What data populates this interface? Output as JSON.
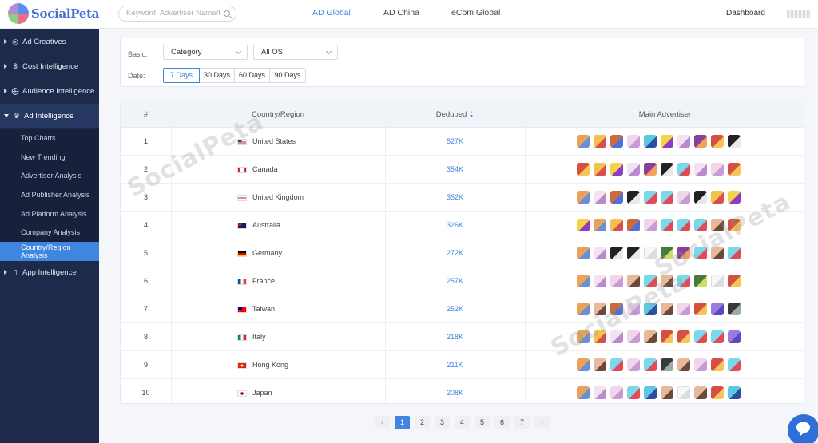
{
  "header": {
    "logo_text": "SocialPeta",
    "search_placeholder": "Keyword, Advertiser Name/ID",
    "tabs": [
      {
        "label": "AD Global",
        "active": true
      },
      {
        "label": "AD China",
        "active": false
      },
      {
        "label": "eCom Global",
        "active": false
      }
    ],
    "dashboard_label": "Dashboard"
  },
  "sidebar": {
    "main_items": [
      {
        "label": "Ad Creatives",
        "icon": "lightbulb-icon"
      },
      {
        "label": "Cost Intelligence",
        "icon": "dollar-icon"
      },
      {
        "label": "Audience Intelligence",
        "icon": "target-icon"
      },
      {
        "label": "Ad Intelligence",
        "icon": "trophy-icon",
        "open": true
      },
      {
        "label": "App Intelligence",
        "icon": "phone-icon"
      }
    ],
    "sub_items": [
      {
        "label": "Top Charts"
      },
      {
        "label": "New Trending"
      },
      {
        "label": "Advertiser Analysis"
      },
      {
        "label": "Ad Publisher Analysis"
      },
      {
        "label": "Ad Platform Analysis"
      },
      {
        "label": "Company Analysis"
      },
      {
        "label": "Country/Region Analysis",
        "active": true
      }
    ]
  },
  "filters": {
    "basic_label": "Basic:",
    "date_label": "Date:",
    "category_value": "Category",
    "os_value": "All OS",
    "date_options": [
      "7 Days",
      "30 Days",
      "60 Days",
      "90 Days"
    ],
    "date_selected": "7 Days"
  },
  "table": {
    "headers": {
      "rank": "#",
      "country": "Country/Region",
      "deduped": "Deduped",
      "advertiser": "Main Advertiser"
    },
    "rows": [
      {
        "rank": "1",
        "country": "United States",
        "flag": "us",
        "deduped": "527K"
      },
      {
        "rank": "2",
        "country": "Canada",
        "flag": "ca",
        "deduped": "354K"
      },
      {
        "rank": "3",
        "country": "United Kingdom",
        "flag": "gb",
        "deduped": "352K"
      },
      {
        "rank": "4",
        "country": "Australia",
        "flag": "au",
        "deduped": "326K"
      },
      {
        "rank": "5",
        "country": "Germany",
        "flag": "de",
        "deduped": "272K"
      },
      {
        "rank": "6",
        "country": "France",
        "flag": "fr",
        "deduped": "257K"
      },
      {
        "rank": "7",
        "country": "Taiwan",
        "flag": "tw",
        "deduped": "252K"
      },
      {
        "rank": "8",
        "country": "Italy",
        "flag": "it",
        "deduped": "218K"
      },
      {
        "rank": "9",
        "country": "Hong Kong",
        "flag": "hk",
        "deduped": "211K"
      },
      {
        "rank": "10",
        "country": "Japan",
        "flag": "jp",
        "deduped": "208K"
      }
    ]
  },
  "watermark_text": "SocialPeta",
  "pagination": {
    "pages": [
      "1",
      "2",
      "3",
      "4",
      "5",
      "6",
      "7"
    ],
    "current": "1",
    "prev": "‹",
    "next": "›"
  },
  "colors": {
    "accent": "#3f86e0",
    "sidebar_bg": "#1e2a4a",
    "chat_button": "#2f6fd8"
  }
}
